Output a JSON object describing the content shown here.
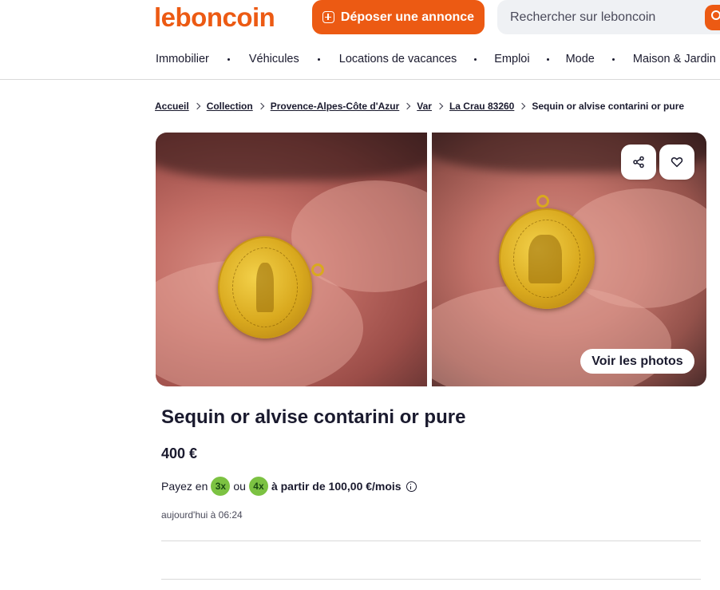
{
  "header": {
    "logo": "leboncoin",
    "post_button": "Déposer une annonce",
    "search_placeholder": "Rechercher sur leboncoin"
  },
  "nav": {
    "items": [
      "Immobilier",
      "Véhicules",
      "Locations de vacances",
      "Emploi",
      "Mode",
      "Maison & Jardin"
    ]
  },
  "breadcrumb": {
    "items": [
      "Accueil",
      "Collection",
      "Provence-Alpes-Côte d'Azur",
      "Var",
      "La Crau 83260"
    ],
    "current": "Sequin or alvise contarini or pure"
  },
  "gallery": {
    "view_photos": "Voir les photos",
    "share_icon": "share-icon",
    "favorite_icon": "heart-icon"
  },
  "listing": {
    "title": "Sequin or alvise contarini or pure",
    "price": "400 €",
    "payment": {
      "prefix": "Payez en",
      "badge_3x": "3x",
      "or": "ou",
      "badge_4x": "4x",
      "suffix": "à partir de 100,00 €/mois"
    },
    "date": "aujourd'hui à 06:24"
  },
  "colors": {
    "brand": "#ec5a13",
    "badge": "#7cc242",
    "text": "#1a1a2e"
  }
}
